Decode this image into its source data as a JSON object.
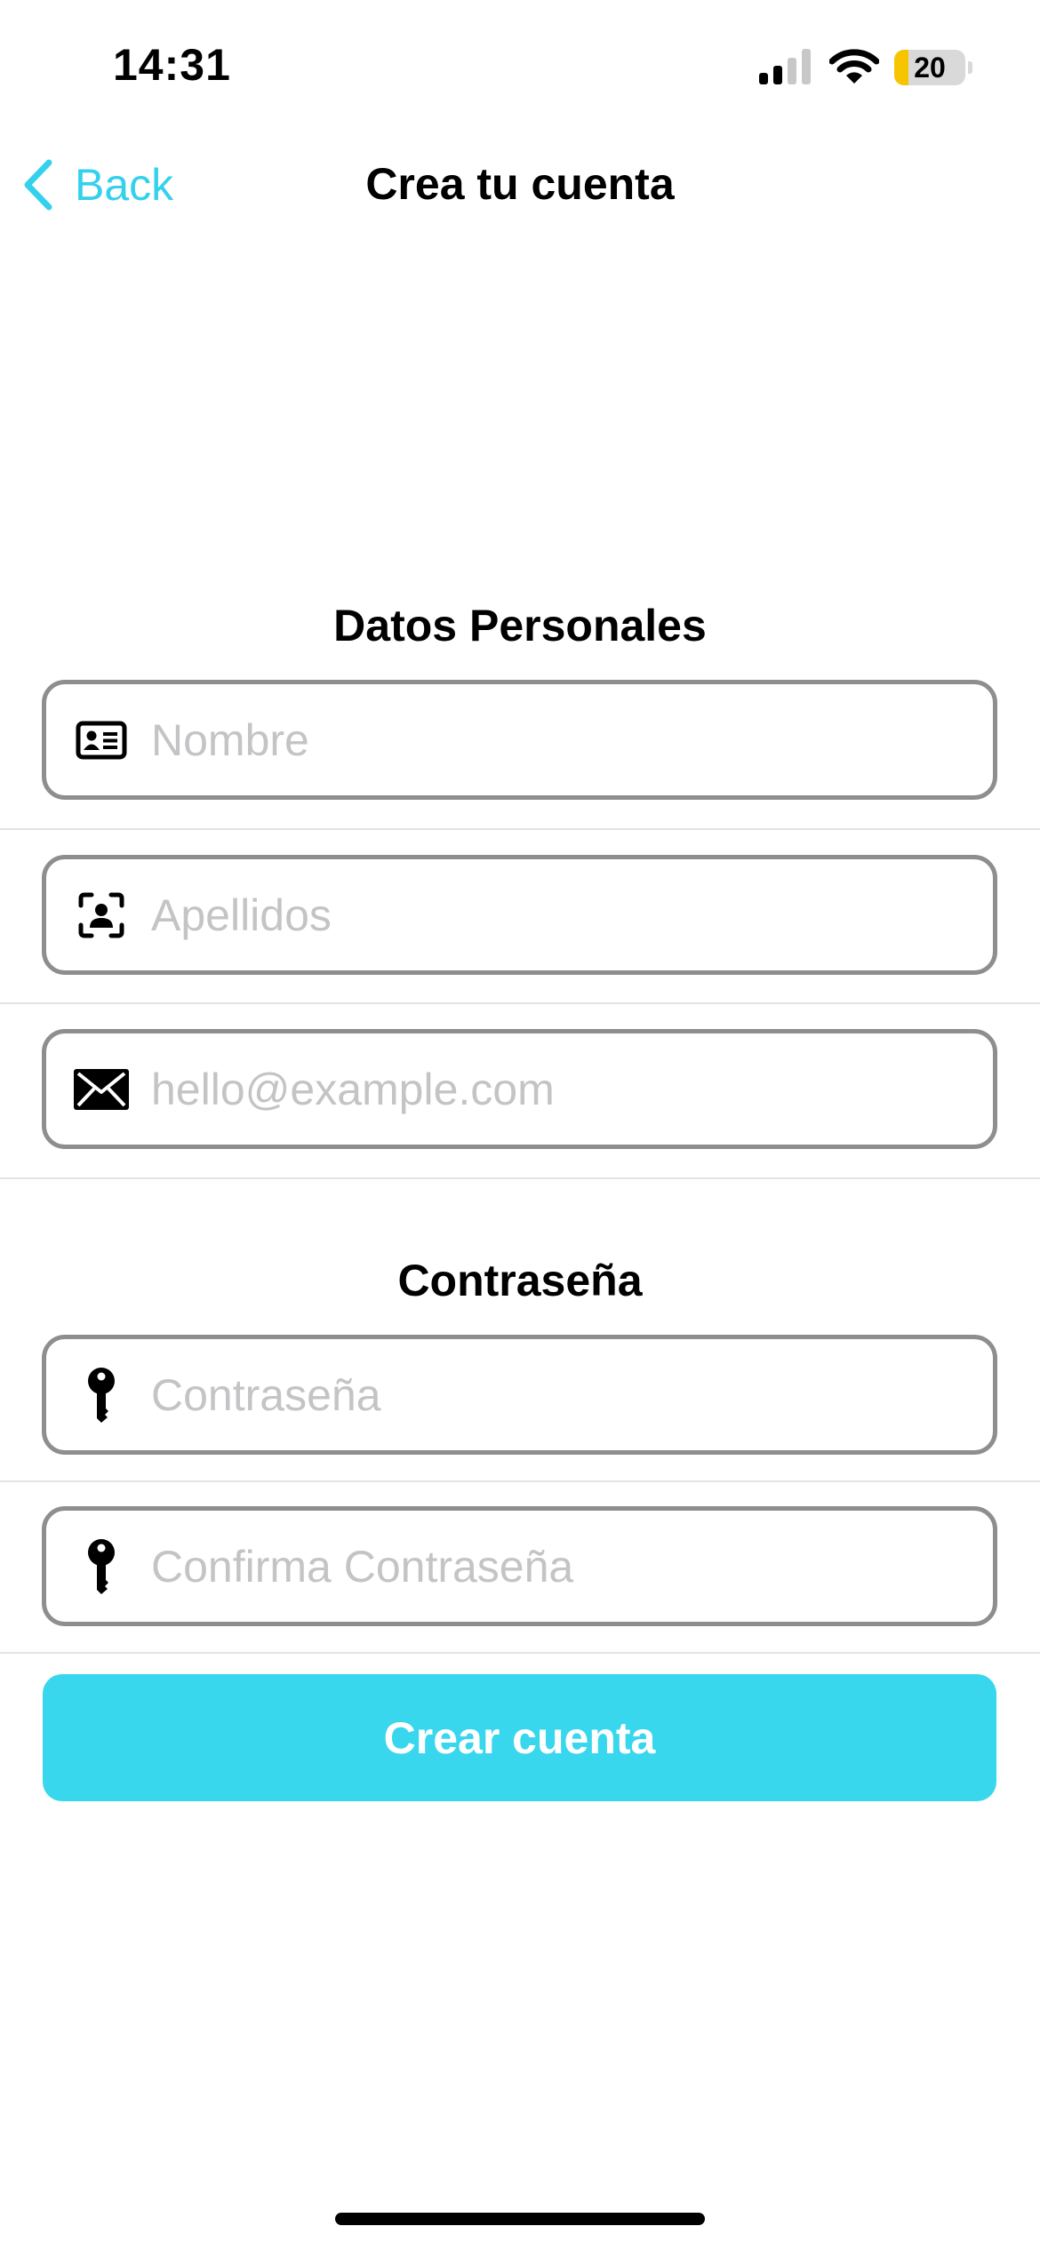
{
  "status_bar": {
    "time": "14:31",
    "battery_level": "20",
    "battery_color": "#f7c500"
  },
  "nav": {
    "back_label": "Back",
    "title": "Crea tu cuenta",
    "accent_color": "#33d1eb"
  },
  "personal_section": {
    "title": "Datos Personales",
    "fields": [
      {
        "icon": "id-card-icon",
        "placeholder": "Nombre",
        "value": ""
      },
      {
        "icon": "person-viewfinder-icon",
        "placeholder": "Apellidos",
        "value": ""
      },
      {
        "icon": "envelope-icon",
        "placeholder": "hello@example.com",
        "value": ""
      }
    ]
  },
  "password_section": {
    "title": "Contraseña",
    "fields": [
      {
        "icon": "key-icon",
        "placeholder": "Contraseña",
        "value": ""
      },
      {
        "icon": "key-icon",
        "placeholder": "Confirma Contraseña",
        "value": ""
      }
    ]
  },
  "submit": {
    "label": "Crear cuenta",
    "color": "#38d7ee"
  }
}
